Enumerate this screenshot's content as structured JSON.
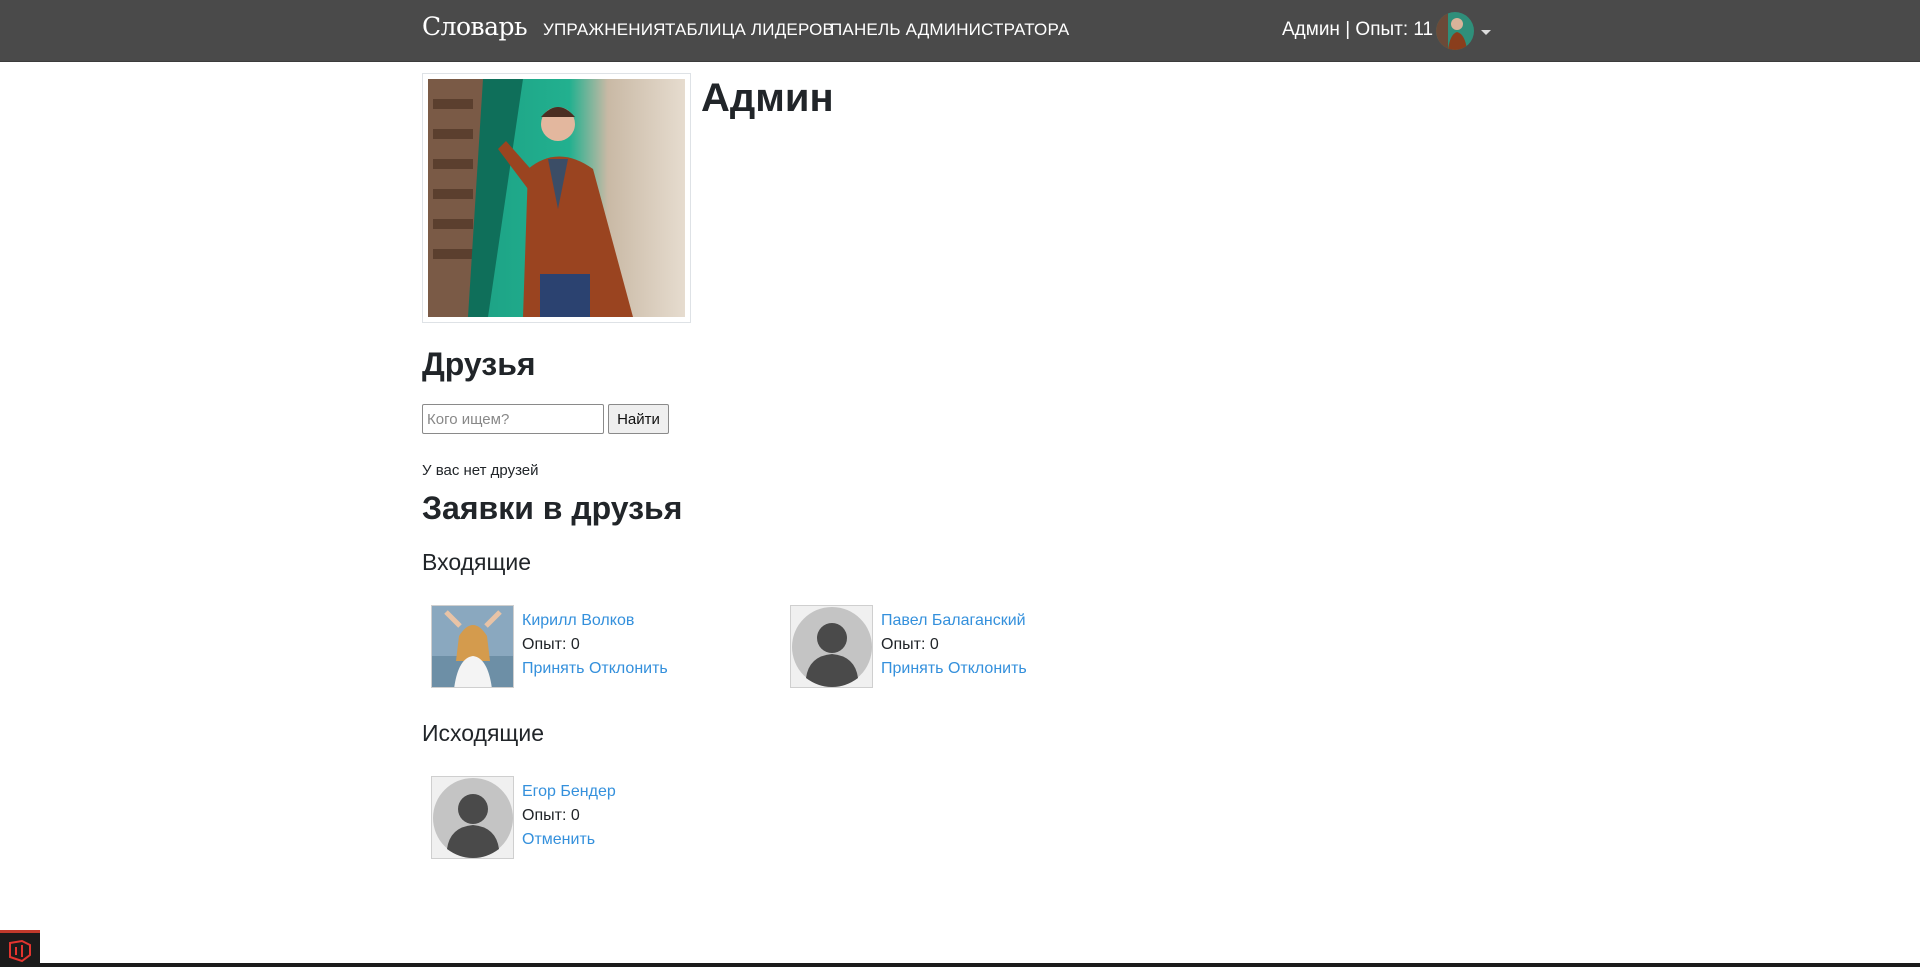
{
  "nav": {
    "brand": "Словарь",
    "links": [
      "УПРАЖНЕНИЯ",
      "ТАБЛИЦА ЛИДЕРОВ",
      "ПАНЕЛЬ АДМИНИСТРАТОРА"
    ],
    "user_info": "Админ | Опыт: 11"
  },
  "profile": {
    "name": "Админ"
  },
  "friends": {
    "heading": "Друзья",
    "search_placeholder": "Кого ищем?",
    "search_button": "Найти",
    "empty_text": "У вас нет друзей"
  },
  "requests": {
    "heading": "Заявки в друзья",
    "incoming_heading": "Входящие",
    "outgoing_heading": "Исходящие",
    "incoming": [
      {
        "name": "Кирилл Волков",
        "xp": "Опыт: 0",
        "accept": "Принять",
        "decline": "Отклонить"
      },
      {
        "name": "Павел Балаганский",
        "xp": "Опыт: 0",
        "accept": "Принять",
        "decline": "Отклонить"
      }
    ],
    "outgoing": [
      {
        "name": "Егор Бендер",
        "xp": "Опыт: 0",
        "cancel": "Отменить"
      }
    ]
  },
  "colors": {
    "navbar": "#4a4a4a",
    "link": "#3490dc",
    "text": "#212529"
  }
}
